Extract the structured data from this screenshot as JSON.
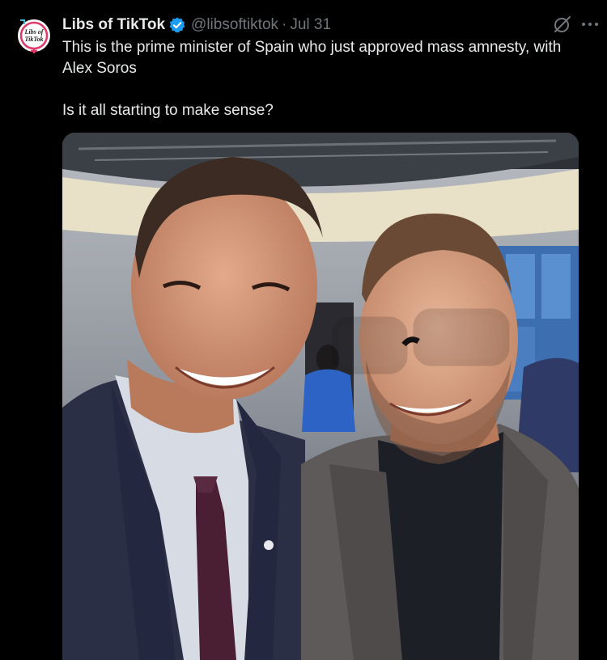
{
  "author": {
    "display_name": "Libs of TikTok",
    "handle": "@libsoftiktok",
    "date": "Jul 31",
    "verified": true,
    "avatar_text_line1": "Libs of",
    "avatar_text_line2": "TikTok"
  },
  "tweet": {
    "paragraph1": "This is the prime minister of Spain who just approved mass amnesty, with Alex Soros",
    "paragraph2": "Is it all starting to make sense?"
  },
  "icons": {
    "verified": "verified-badge-icon",
    "grok": "grok-icon",
    "more": "more-options-icon"
  },
  "colors": {
    "background": "#000000",
    "text_primary": "#e7e9ea",
    "text_secondary": "#71767b",
    "verified_blue": "#1d9bf0"
  }
}
